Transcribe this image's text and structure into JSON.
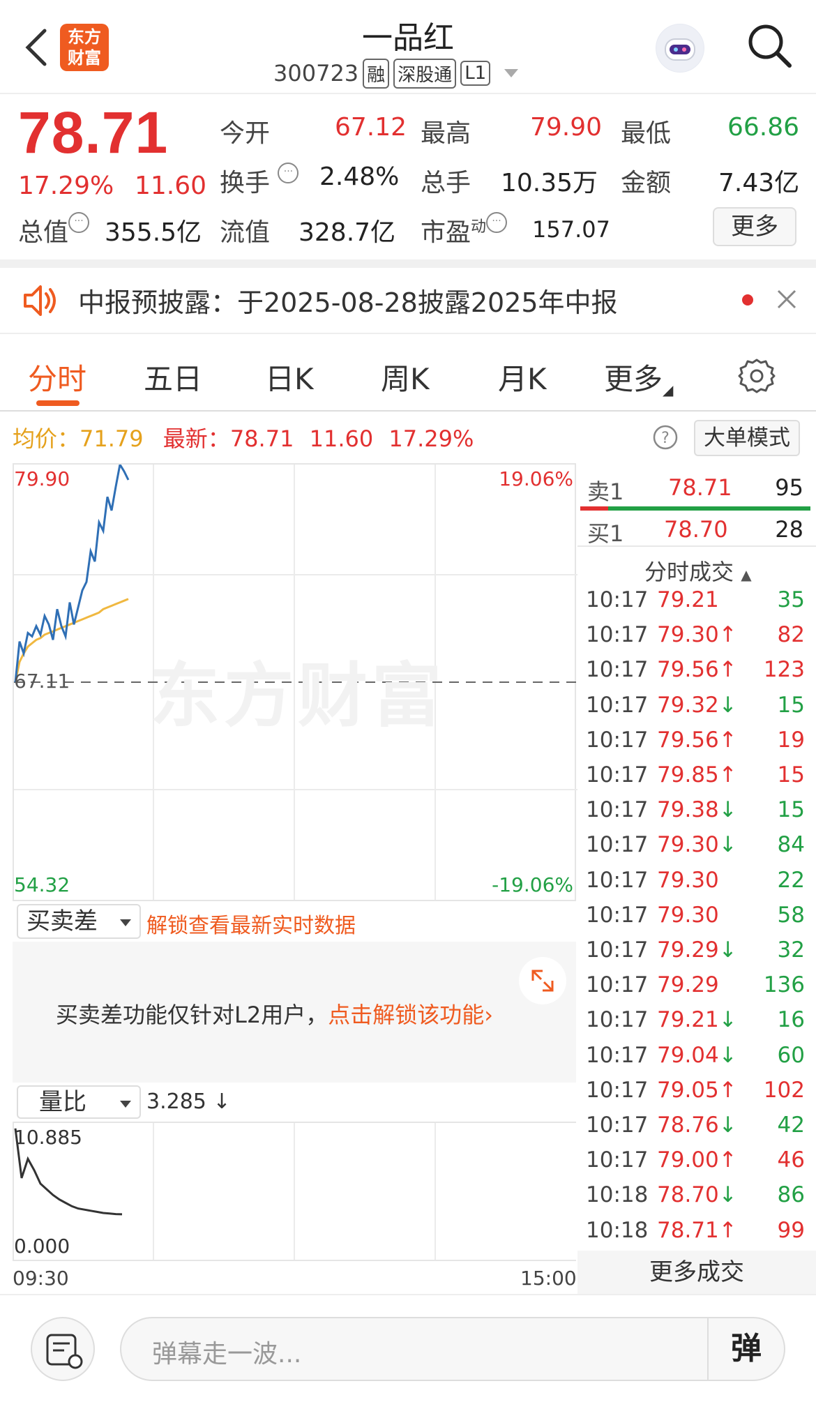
{
  "header": {
    "title": "一品红",
    "code": "300723",
    "tags": [
      "融",
      "深股通",
      "L1"
    ],
    "logo_line1": "东方",
    "logo_line2": "财富"
  },
  "quote": {
    "price": "78.71",
    "change_pct": "17.29%",
    "change_amt": "11.60",
    "open_label": "今开",
    "open": "67.12",
    "high_label": "最高",
    "high": "79.90",
    "low_label": "最低",
    "low": "66.86",
    "turnover_label": "换手",
    "turnover": "2.48%",
    "volume_label": "总手",
    "volume": "10.35万",
    "amount_label": "金额",
    "amount": "7.43亿",
    "mktcap_label": "总值",
    "mktcap": "355.5亿",
    "float_label": "流值",
    "float": "328.7亿",
    "pe_label": "市盈",
    "pe_sup": "动",
    "pe": "157.07",
    "more_label": "更多"
  },
  "notice": {
    "text": "中报预披露：于2025-08-28披露2025年中报"
  },
  "tabs": [
    "分时",
    "五日",
    "日K",
    "周K",
    "月K",
    "更多"
  ],
  "info": {
    "avg_label": "均价：",
    "avg": "71.79",
    "latest_label": "最新：",
    "latest": "78.71",
    "latest_chg": "11.60",
    "latest_pct": "17.29%",
    "mode_label": "大单模式"
  },
  "chart_data": {
    "type": "line",
    "y_top": "79.90",
    "y_base": "67.11",
    "y_bottom": "54.32",
    "pct_top": "19.06%",
    "pct_bottom": "-19.06%",
    "x_start": "09:30",
    "x_end": "15:00",
    "price_series": [
      67.1,
      69.5,
      68.8,
      70.0,
      69.8,
      70.4,
      69.9,
      71.0,
      70.5,
      69.6,
      71.4,
      70.4,
      69.8,
      71.8,
      70.5,
      71.5,
      72.5,
      73.0,
      74.8,
      74.2,
      76.5,
      76.0,
      78.0,
      77.2,
      78.6,
      79.9,
      79.5,
      79.0
    ],
    "avg_series": [
      67.1,
      68.3,
      68.8,
      69.2,
      69.4,
      69.6,
      69.7,
      69.9,
      70.0,
      70.1,
      70.2,
      70.3,
      70.4,
      70.5,
      70.6,
      70.7,
      70.8,
      70.9,
      71.0,
      71.1,
      71.2,
      71.4,
      71.5,
      71.6,
      71.7,
      71.8,
      71.9,
      72.0
    ]
  },
  "orderbook": {
    "sell_label": "卖1",
    "sell_price": "78.71",
    "sell_vol": "95",
    "buy_label": "买1",
    "buy_price": "78.70",
    "buy_vol": "28"
  },
  "ticks_title": "分时成交",
  "ticks": [
    {
      "t": "10:17",
      "p": "79.21",
      "d": "",
      "v": "35",
      "vc": "g"
    },
    {
      "t": "10:17",
      "p": "79.30",
      "d": "↑",
      "v": "82",
      "vc": "r"
    },
    {
      "t": "10:17",
      "p": "79.56",
      "d": "↑",
      "v": "123",
      "vc": "r"
    },
    {
      "t": "10:17",
      "p": "79.32",
      "d": "↓",
      "v": "15",
      "vc": "g"
    },
    {
      "t": "10:17",
      "p": "79.56",
      "d": "↑",
      "v": "19",
      "vc": "r"
    },
    {
      "t": "10:17",
      "p": "79.85",
      "d": "↑",
      "v": "15",
      "vc": "r"
    },
    {
      "t": "10:17",
      "p": "79.38",
      "d": "↓",
      "v": "15",
      "vc": "g"
    },
    {
      "t": "10:17",
      "p": "79.30",
      "d": "↓",
      "v": "84",
      "vc": "g"
    },
    {
      "t": "10:17",
      "p": "79.30",
      "d": "",
      "v": "22",
      "vc": "g"
    },
    {
      "t": "10:17",
      "p": "79.30",
      "d": "",
      "v": "58",
      "vc": "g"
    },
    {
      "t": "10:17",
      "p": "79.29",
      "d": "↓",
      "v": "32",
      "vc": "g"
    },
    {
      "t": "10:17",
      "p": "79.29",
      "d": "",
      "v": "136",
      "vc": "g"
    },
    {
      "t": "10:17",
      "p": "79.21",
      "d": "↓",
      "v": "16",
      "vc": "g"
    },
    {
      "t": "10:17",
      "p": "79.04",
      "d": "↓",
      "v": "60",
      "vc": "g"
    },
    {
      "t": "10:17",
      "p": "79.05",
      "d": "↑",
      "v": "102",
      "vc": "r"
    },
    {
      "t": "10:17",
      "p": "78.76",
      "d": "↓",
      "v": "42",
      "vc": "g"
    },
    {
      "t": "10:17",
      "p": "79.00",
      "d": "↑",
      "v": "46",
      "vc": "r"
    },
    {
      "t": "10:18",
      "p": "78.70",
      "d": "↓",
      "v": "86",
      "vc": "g"
    },
    {
      "t": "10:18",
      "p": "78.71",
      "d": "↑",
      "v": "99",
      "vc": "r"
    }
  ],
  "more_ticks": "更多成交",
  "spread": {
    "dropdown": "买卖差",
    "unlock_text": "解锁查看最新实时数据",
    "msg": "买卖差功能仅针对L2用户，",
    "msg_link": "点击解锁该功能"
  },
  "volratio": {
    "dropdown": "量比",
    "value": "3.285 ↓",
    "top": "10.885",
    "bottom": "0.000",
    "series": [
      10.9,
      6.5,
      8.2,
      7.2,
      6.0,
      5.5,
      5.0,
      4.6,
      4.3,
      4.0,
      3.8,
      3.7,
      3.6,
      3.5,
      3.4,
      3.35,
      3.3,
      3.285
    ]
  },
  "danmu": {
    "placeholder": "弹幕走一波...",
    "button": "弹"
  }
}
